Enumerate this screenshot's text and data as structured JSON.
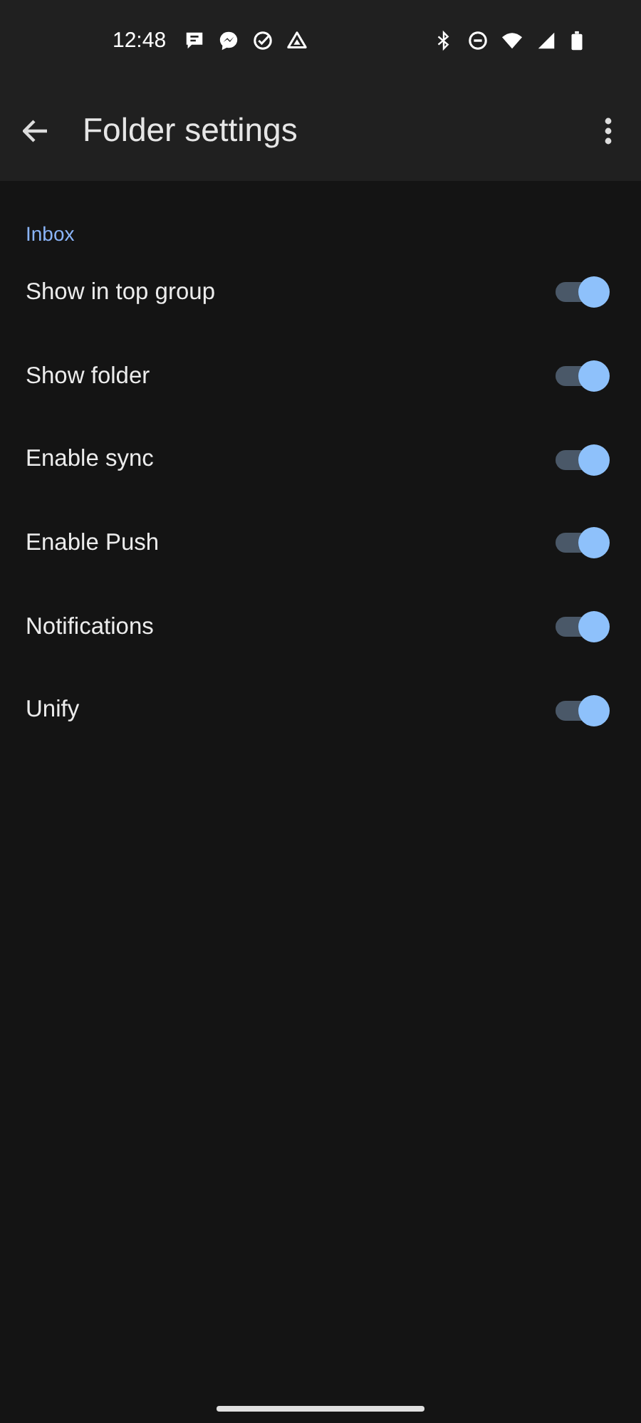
{
  "status_bar": {
    "time": "12:48"
  },
  "app_bar": {
    "title": "Folder settings"
  },
  "section": {
    "title": "Inbox"
  },
  "settings": [
    {
      "label": "Show in top group",
      "on": true
    },
    {
      "label": "Show folder",
      "on": true
    },
    {
      "label": "Enable sync",
      "on": true
    },
    {
      "label": "Enable Push",
      "on": true
    },
    {
      "label": "Notifications",
      "on": true
    },
    {
      "label": "Unify",
      "on": true
    }
  ]
}
